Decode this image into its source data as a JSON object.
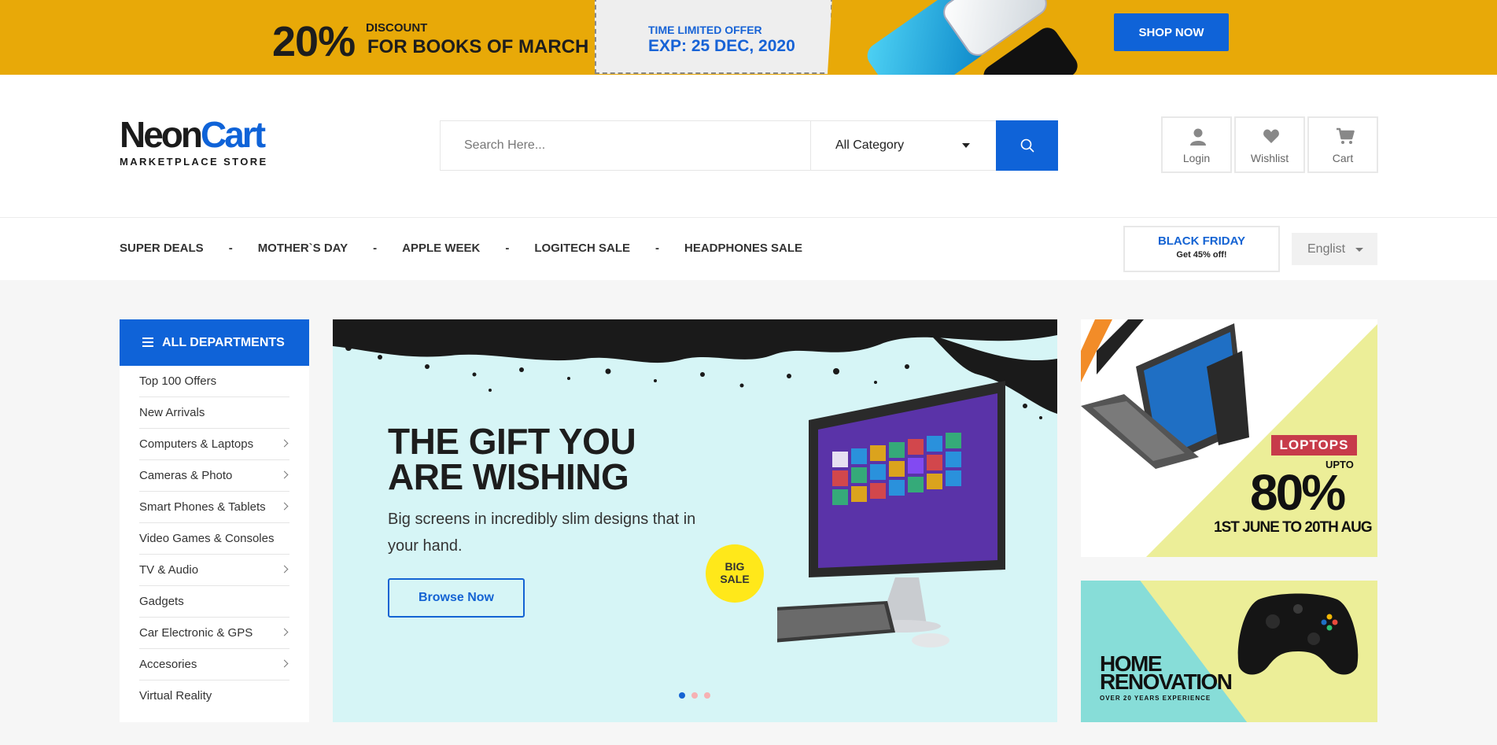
{
  "promo": {
    "percent": "20%",
    "discount_label": "DISCOUNT",
    "books_label": "FOR BOOKS OF MARCH",
    "offer_label": "TIME LIMITED OFFER",
    "expiry": "EXP: 25 DEC, 2020",
    "shop_button": "SHOP NOW"
  },
  "header": {
    "brand_a": "Neon",
    "brand_b": "Cart",
    "tagline": "MARKETPLACE STORE",
    "search_placeholder": "Search Here...",
    "category_selected": "All Category",
    "account": {
      "login": "Login",
      "wishlist": "Wishlist",
      "cart": "Cart"
    }
  },
  "nav": {
    "links": [
      "SUPER DEALS",
      "MOTHER`S DAY",
      "APPLE WEEK",
      "LOGITECH SALE",
      "HEADPHONES SALE"
    ],
    "separator": "-",
    "black_friday_title": "BLACK FRIDAY",
    "black_friday_sub": "Get 45% off!",
    "language": "Englist"
  },
  "departments": {
    "title": "ALL DEPARTMENTS",
    "items": [
      {
        "label": "Top 100 Offers",
        "has_sub": false
      },
      {
        "label": "New Arrivals",
        "has_sub": false
      },
      {
        "label": "Computers & Laptops",
        "has_sub": true
      },
      {
        "label": "Cameras & Photo",
        "has_sub": true
      },
      {
        "label": "Smart Phones & Tablets",
        "has_sub": true
      },
      {
        "label": "Video Games & Consoles",
        "has_sub": false
      },
      {
        "label": "TV & Audio",
        "has_sub": true
      },
      {
        "label": "Gadgets",
        "has_sub": false
      },
      {
        "label": "Car Electronic & GPS",
        "has_sub": true
      },
      {
        "label": "Accesories",
        "has_sub": true
      },
      {
        "label": "Virtual Reality",
        "has_sub": false
      }
    ]
  },
  "hero": {
    "title_line1": "THE GIFT YOU",
    "title_line2": "ARE WISHING",
    "subtitle": "Big screens in incredibly slim designs that in your hand.",
    "button": "Browse Now",
    "badge_line1": "BIG",
    "badge_line2": "SALE",
    "slide_count": 3,
    "active_slide": 1
  },
  "banner_laptops": {
    "tag": "LOPTOPS",
    "upto": "UPTO",
    "percent": "80%",
    "dates": "1ST JUNE TO 20TH AUG"
  },
  "banner_home": {
    "line1": "HOME",
    "line2": "RENOVATION",
    "sub": "OVER 20 YEARS EXPERIENCE"
  },
  "colors": {
    "primary": "#0f63d8",
    "promo_bg": "#e8a908",
    "hero_bg": "#d6f5f6",
    "loptop_tag": "#c73b4a",
    "banner_yellow": "#ecee98",
    "banner_teal": "#87ddd8"
  },
  "icons": {
    "search": "search-icon",
    "login": "user-icon",
    "wishlist": "heart-icon",
    "cart": "cart-icon",
    "menu": "menu-icon"
  }
}
